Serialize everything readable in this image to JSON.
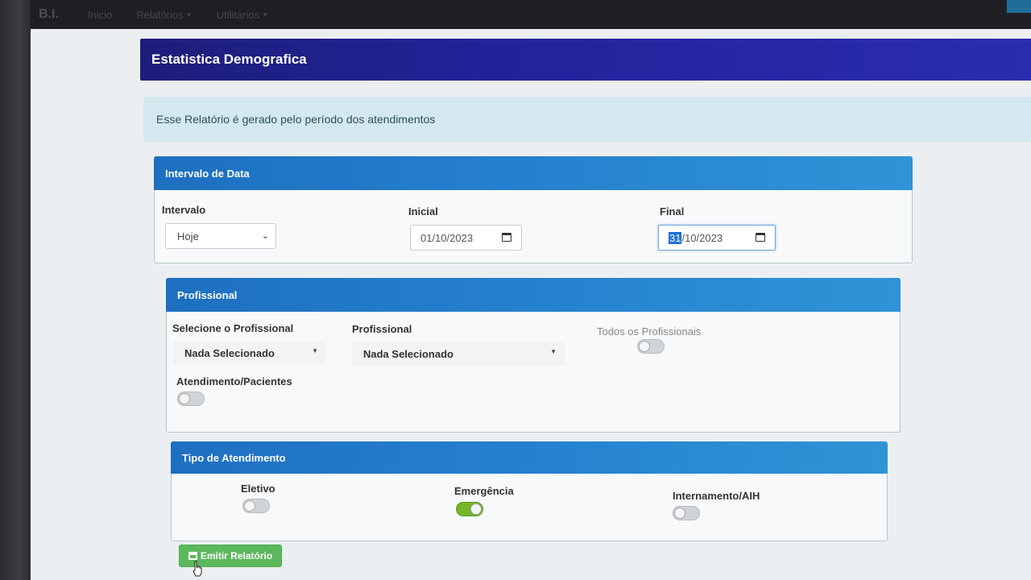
{
  "navbar": {
    "brand": "B.I.",
    "links": [
      "Inicio",
      "Relatórios",
      "Utilitários"
    ]
  },
  "header": {
    "title": "Estatistica Demografica"
  },
  "info": {
    "text": "Esse Relatório é gerado pelo período dos atendimentos"
  },
  "date_panel": {
    "title": "Intervalo de Data",
    "interval_label": "Intervalo",
    "interval_value": "Hoje",
    "start_label": "Inicial",
    "start_value": "01/10/2023",
    "end_label": "Final",
    "end_day": "31",
    "end_rest": "/10/2023"
  },
  "prof_panel": {
    "title": "Profissional",
    "select_label": "Selecione o Profissional",
    "select_value": "Nada Selecionado",
    "prof_label": "Profissional",
    "prof_value": "Nada Selecionado",
    "all_label": "Todos os Profissionais",
    "att_label": "Atendimento/Pacientes"
  },
  "type_panel": {
    "title": "Tipo de Atendimento",
    "elective": "Eletivo",
    "emergency": "Emergência",
    "hospitalization": "Internamento/AIH"
  },
  "toggles": {
    "all_professionals": false,
    "attendance": false,
    "elective": false,
    "emergency": true,
    "hospitalization": false
  },
  "actions": {
    "emit_label": "Emitir Relatório"
  },
  "colors": {
    "header": "#22239a",
    "panel_head": "#2581cf",
    "info_bg": "#d4e9ef",
    "toggle_on": "#76b52a",
    "button": "#5cb85c"
  }
}
